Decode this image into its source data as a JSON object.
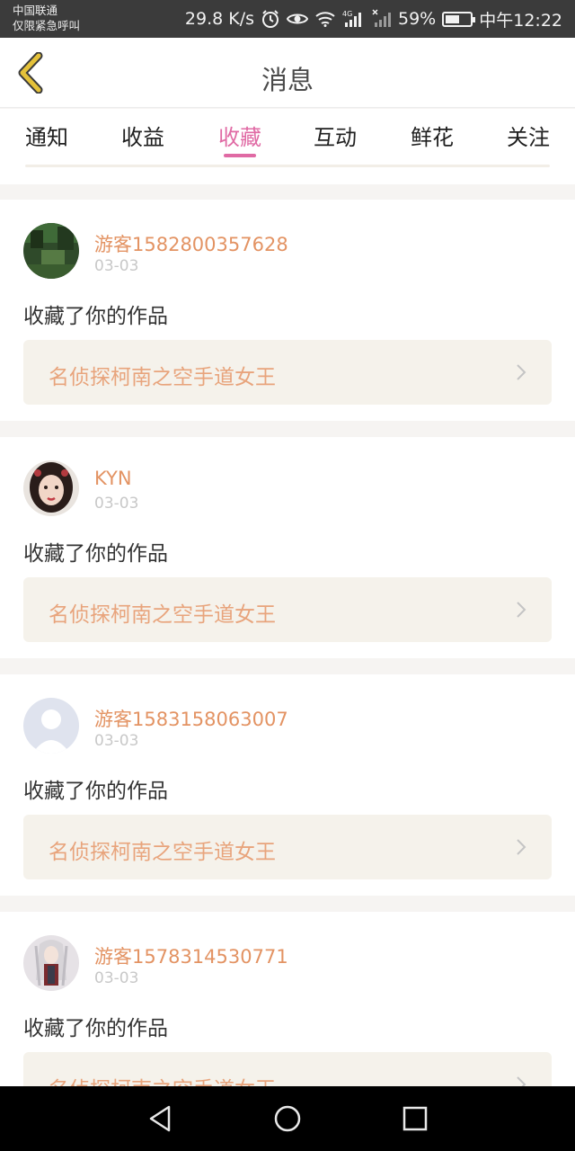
{
  "status_bar": {
    "carrier_line1": "中国联通",
    "carrier_line2": "仅限紧急呼叫",
    "network_speed": "29.8 K/s",
    "network_type": "4G",
    "battery_percent": "59%",
    "battery_level": 0.59,
    "time": "中午12:22"
  },
  "header": {
    "title": "消息",
    "back_icon": "chevron-left-icon",
    "accent_color": "#e5c23a"
  },
  "tabs": [
    {
      "label": "通知"
    },
    {
      "label": "收益"
    },
    {
      "label": "收藏",
      "active": true
    },
    {
      "label": "互动"
    },
    {
      "label": "鲜花"
    },
    {
      "label": "关注"
    }
  ],
  "theme": {
    "active_tab_color": "#e06aa4",
    "username_color": "#e39363",
    "work_title_color": "#e8a47c"
  },
  "items": [
    {
      "avatar": "forest-avatar",
      "username": "游客1582800357628",
      "date": "03-03",
      "action": "收藏了你的作品",
      "work_title": "名侦探柯南之空手道女王"
    },
    {
      "avatar": "woman-avatar",
      "username": "KYN",
      "date": "03-03",
      "action": "收藏了你的作品",
      "work_title": "名侦探柯南之空手道女王"
    },
    {
      "avatar": "default-user-avatar",
      "username": "游客1583158063007",
      "date": "03-03",
      "action": "收藏了你的作品",
      "work_title": "名侦探柯南之空手道女王"
    },
    {
      "avatar": "anime-character-avatar",
      "username": "游客1578314530771",
      "date": "03-03",
      "action": "收藏了你的作品",
      "work_title": "名侦探柯南之空手道女王"
    }
  ],
  "nav_bar": {
    "back": "triangle-back-icon",
    "home": "circle-home-icon",
    "recents": "square-recents-icon"
  }
}
